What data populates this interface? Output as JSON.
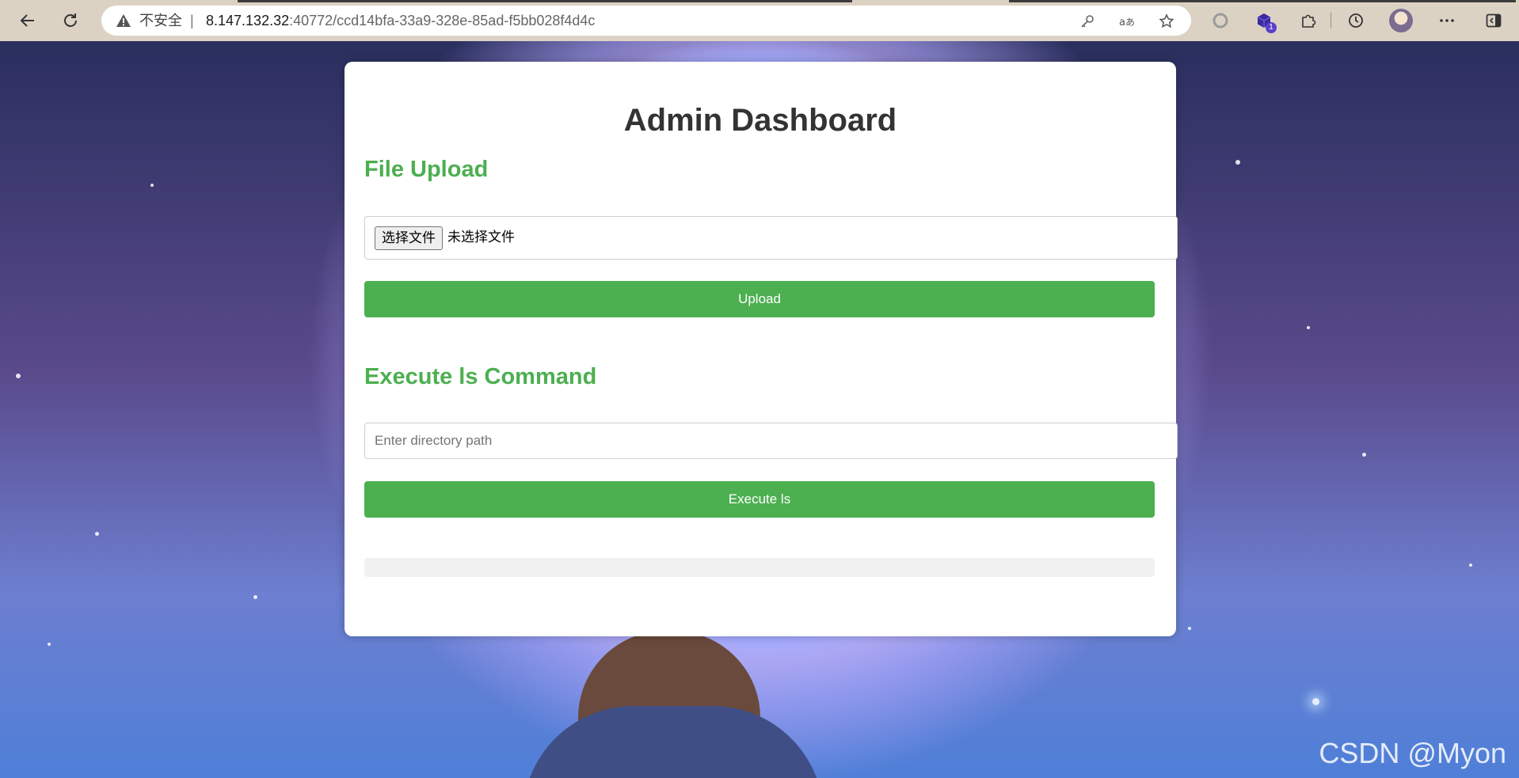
{
  "browser": {
    "security_label": "不安全",
    "separator": "|",
    "url_host": "8.147.132.32",
    "url_rest": ":40772/ccd14bfa-33a9-328e-85ad-f5bb028f4d4c",
    "extension_badge": "1",
    "icons": [
      "back-arrow-icon",
      "reload-icon",
      "warning-icon",
      "key-icon",
      "translate-icon",
      "star-icon",
      "circle-extension-icon",
      "cube-extension-icon",
      "puzzle-icon",
      "history-icon",
      "more-icon",
      "sidebar-icon"
    ]
  },
  "dashboard": {
    "title": "Admin Dashboard",
    "upload": {
      "heading": "File Upload",
      "choose_button": "选择文件",
      "no_file_text": "未选择文件",
      "submit_label": "Upload"
    },
    "execute": {
      "heading": "Execute ls Command",
      "placeholder": "Enter directory path",
      "value": "",
      "submit_label": "Execute ls"
    },
    "output": ""
  },
  "watermark": "CSDN @Myon",
  "colors": {
    "accent": "#4caf50",
    "title": "#333333",
    "chrome": "#dcd2c4"
  }
}
